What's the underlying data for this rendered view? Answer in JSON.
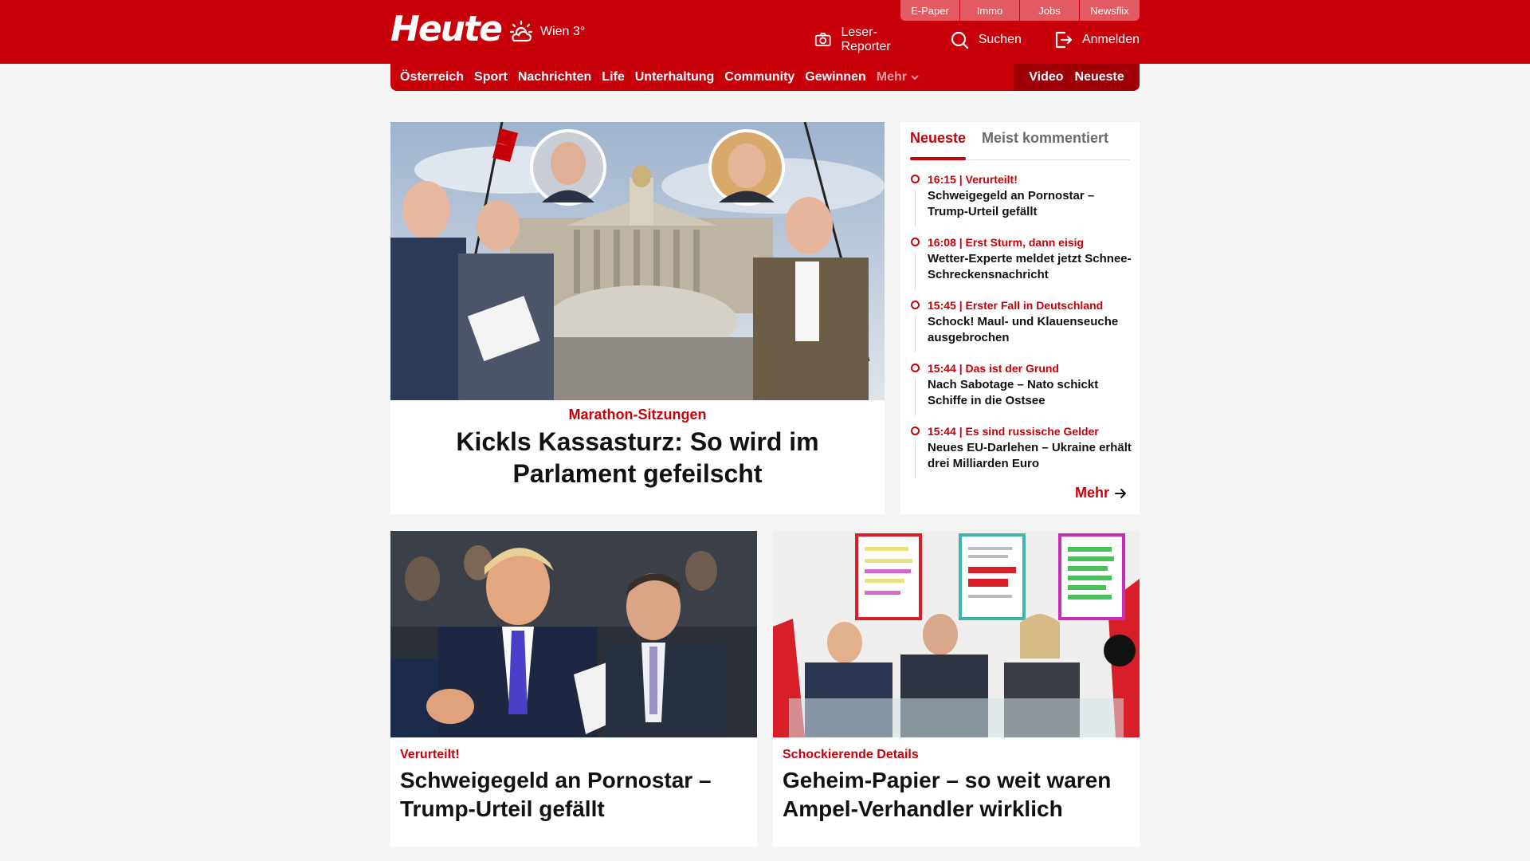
{
  "header": {
    "logo_text": "Heute",
    "weather_text": "Wien 3°",
    "weather_icon": "sun-cloud-icon",
    "service_tabs": [
      "E-Paper",
      "Immo",
      "Jobs",
      "Newsflix"
    ],
    "actions": [
      {
        "label": "Leser-Reporter",
        "icon": "camera-icon"
      },
      {
        "label": "Suchen",
        "icon": "search-icon"
      },
      {
        "label": "Anmelden",
        "icon": "login-icon"
      }
    ],
    "brand_color": "#c8000a"
  },
  "nav": {
    "items": [
      "Österreich",
      "Sport",
      "Nachrichten",
      "Life",
      "Unterhaltung",
      "Community",
      "Gewinnen"
    ],
    "more_label": "Mehr",
    "right_items": [
      "Video",
      "Neueste"
    ]
  },
  "hero": {
    "kicker": "Marathon-Sitzungen",
    "title": "Kickls Kassasturz: So wird im Parlament gefeilscht"
  },
  "sidebar": {
    "tabs": [
      "Neueste",
      "Meist kommentiert"
    ],
    "items": [
      {
        "meta": "16:15 | Verurteilt!",
        "title": "Schweigegeld an Pornostar – Trump-Urteil gefällt"
      },
      {
        "meta": "16:08 | Erst Sturm, dann eisig",
        "title": "Wetter-Experte meldet jetzt Schnee-Schreckensnachricht"
      },
      {
        "meta": "15:45 | Erster Fall in Deutschland",
        "title": "Schock! Maul- und Klauenseuche ausgebrochen"
      },
      {
        "meta": "15:44 | Das ist der Grund",
        "title": "Nach Sabotage – Nato schickt Schiffe in die Ostsee"
      },
      {
        "meta": "15:44 | Es sind russische Gelder",
        "title": "Neues EU-Darlehen – Ukraine erhält drei Milliarden Euro"
      }
    ],
    "more_label": "Mehr"
  },
  "cards": [
    {
      "kicker": "Verurteilt!",
      "title": "Schweigegeld an Pornostar – Trump-Urteil gefällt"
    },
    {
      "kicker": "Schockierende Details",
      "title": "Geheim-Papier – so weit waren Ampel-Verhandler wirklich"
    }
  ]
}
